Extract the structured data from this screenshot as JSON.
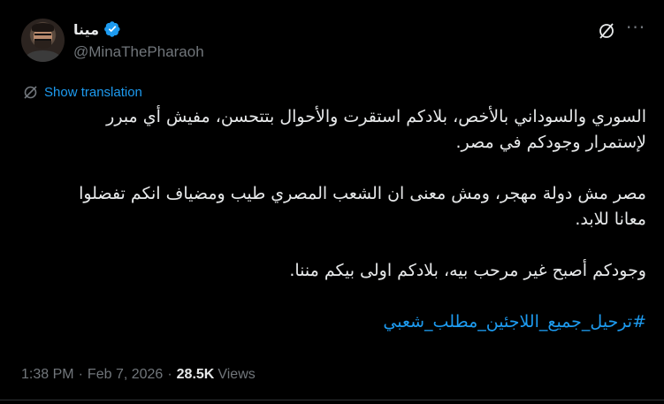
{
  "user": {
    "display_name": "مينا",
    "handle": "@MinaThePharaoh",
    "verified_icon": "verified-badge-icon",
    "accent_color": "#1d9bf0"
  },
  "header": {
    "grok_icon": "grok-icon",
    "more_icon": "more-options-icon"
  },
  "translation": {
    "icon": "translate-icon",
    "label": "Show translation"
  },
  "tweet": {
    "paragraphs": [
      "السوري والسوداني بالأخص، بلادكم استقرت والأحوال بتتحسن، مفيش أي مبرر",
      "لإستمرار وجودكم في مصر.",
      "مصر مش دولة مهجر، ومش معنى ان الشعب المصري طيب ومضياف انكم تفضلوا",
      "معانا للابد.",
      "وجودكم أصبح غير مرحب بيه، بلادكم اولى بيكم مننا."
    ],
    "hashtag": "#ترحيل_جميع_اللاجئين_مطلب_شعبي"
  },
  "meta": {
    "time": "1:38 PM",
    "date": "Feb 7, 2026",
    "separator": "·",
    "views_count": "28.5K",
    "views_label": "Views"
  }
}
